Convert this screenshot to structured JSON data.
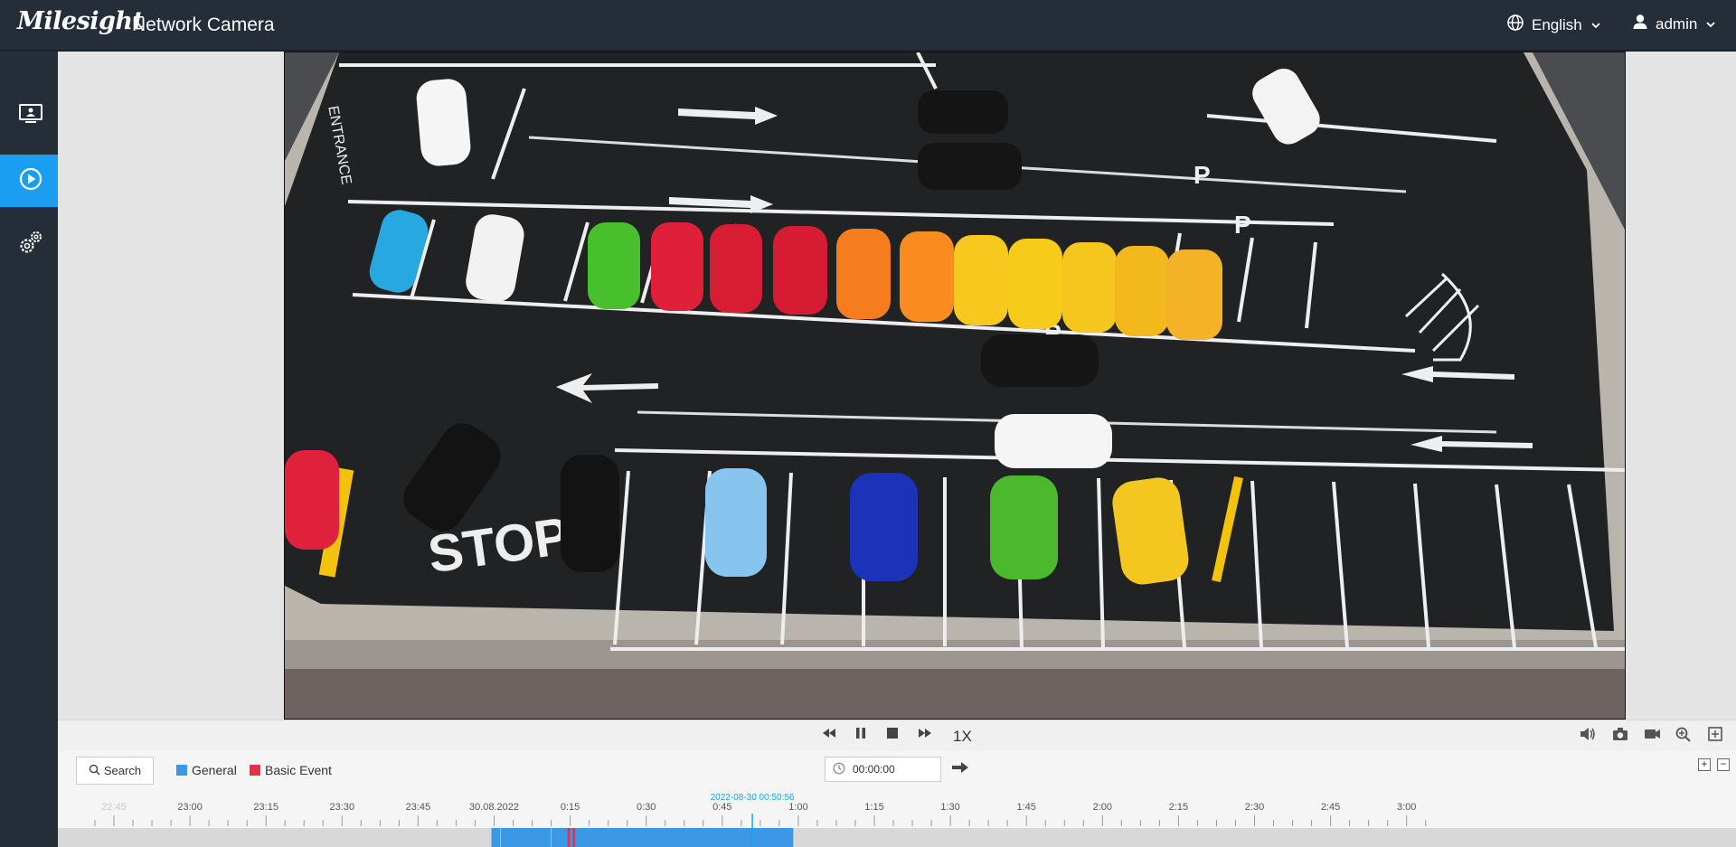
{
  "header": {
    "brand": "Milesight",
    "product": "Network Camera",
    "language": "English",
    "user": "admin"
  },
  "sidebar": {
    "items": [
      {
        "name": "live-view",
        "icon": "monitor-icon",
        "active": false
      },
      {
        "name": "playback",
        "icon": "play-circle-icon",
        "active": true
      },
      {
        "name": "settings",
        "icon": "gear-icon",
        "active": false
      }
    ]
  },
  "playback": {
    "speed": "1X",
    "time_input": "00:00:00"
  },
  "search": {
    "label": "Search"
  },
  "legend": {
    "general": "General",
    "basic_event": "Basic Event",
    "general_color": "#3a98e6",
    "event_color": "#e2334a"
  },
  "timeline": {
    "ticks": [
      "22:45",
      "23:00",
      "23:15",
      "23:30",
      "23:45",
      "30.08.2022",
      "0:15",
      "0:30",
      "0:45",
      "1:00",
      "1:15",
      "1:30",
      "1:45",
      "2:00",
      "2:15",
      "2:30",
      "2:45",
      "3:00"
    ],
    "cursor_label": "2022-08-30 00:50:56",
    "recording_start": "00:00",
    "recording_end": "00:59",
    "event_marks": [
      "00:15",
      "00:16"
    ]
  },
  "colors": {
    "header_bg": "#252d38",
    "accent": "#1a9ff0"
  }
}
